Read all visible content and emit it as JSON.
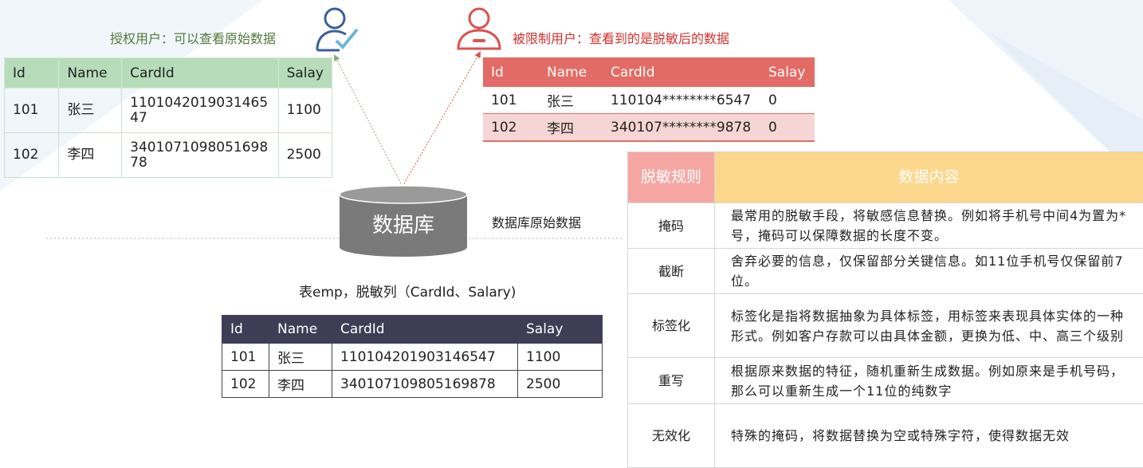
{
  "authorized_label": "授权用户：可以查看原始数据",
  "restricted_label": "被限制用户：查看到的是脱敏后的数据",
  "database_label": "数据库",
  "database_caption": "数据库原始数据",
  "table_caption": "表emp，脱敏列（CardId、Salary)",
  "columns": [
    "Id",
    "Name",
    "CardId",
    "Salay"
  ],
  "authorized_table": {
    "rows": [
      [
        "101",
        "张三",
        "110104201903146547",
        "1100"
      ],
      [
        "102",
        "李四",
        "340107109805169878",
        "2500"
      ]
    ]
  },
  "restricted_table": {
    "rows": [
      [
        "101",
        "张三",
        "110104********6547",
        "0"
      ],
      [
        "102",
        "李四",
        "340107********9878",
        "0"
      ]
    ]
  },
  "raw_table": {
    "rows": [
      [
        "101",
        "张三",
        "110104201903146547",
        "1100"
      ],
      [
        "102",
        "李四",
        "340107109805169878",
        "2500"
      ]
    ]
  },
  "rules_table": {
    "header_left": "脱敏规则",
    "header_right": "数据内容",
    "rows": [
      {
        "name": "掩码",
        "desc": "最常用的脱敏手段，将敏感信息替换。例如将手机号中间4为置为*号，掩码可以保障数据的长度不变。"
      },
      {
        "name": "截断",
        "desc": "舍弃必要的信息，仅保留部分关键信息。如11位手机号仅保留前7位。"
      },
      {
        "name": "标签化",
        "desc": "标签化是指将数据抽象为具体标签，用标签来表现具体实体的一种形式。例如客户存款可以由具体金额，更换为低、中、高三个级别"
      },
      {
        "name": "重写",
        "desc": "根据原来数据的特征，随机重新生成数据。例如原来是手机号码，那么可以重新生成一个11位的纯数字"
      },
      {
        "name": "无效化",
        "desc": "特殊的掩码，将数据替换为空或特殊字符，使得数据无效"
      }
    ]
  },
  "colors": {
    "green_header": "#b7dcb9",
    "red_header": "#e36b65",
    "dark_header": "#3f3d56",
    "rules_left_header": "#f6a7a3",
    "rules_right_header": "#fdd78b",
    "database": "#7a7a7a"
  },
  "icons": {
    "authorized_user": "user-check-icon",
    "restricted_user": "user-restricted-icon",
    "database": "database-icon"
  }
}
